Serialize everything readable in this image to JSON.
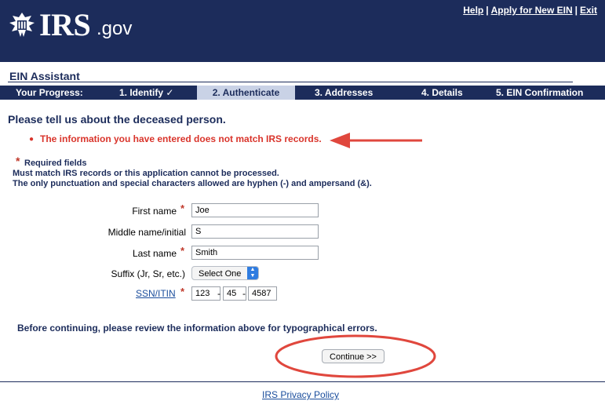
{
  "header": {
    "logo": "IRS",
    "logo_suffix": ".gov",
    "links": [
      "Help",
      "Apply for New EIN",
      "Exit"
    ],
    "separator": "|"
  },
  "assistant_title": "EIN Assistant",
  "progress": {
    "label": "Your Progress:",
    "steps": [
      {
        "label": "1. Identify ✓",
        "state": "complete"
      },
      {
        "label": "2. Authenticate",
        "state": "current"
      },
      {
        "label": "3. Addresses",
        "state": "upcoming"
      },
      {
        "label": "4. Details",
        "state": "upcoming"
      },
      {
        "label": "5. EIN Confirmation",
        "state": "upcoming"
      }
    ]
  },
  "prompt": "Please tell us about the deceased person.",
  "error_message": "The information you have entered does not match IRS records.",
  "required_note": "Required fields",
  "notes": [
    "Must match IRS records or this application cannot be processed.",
    "The only punctuation and special characters allowed are hyphen (-) and ampersand (&)."
  ],
  "form": {
    "first_name": {
      "label": "First name",
      "value": "Joe"
    },
    "middle_name": {
      "label": "Middle name/initial",
      "value": "S"
    },
    "last_name": {
      "label": "Last name",
      "value": "Smith"
    },
    "suffix": {
      "label": "Suffix (Jr, Sr, etc.)",
      "selected": "Select One"
    },
    "ssn": {
      "label": "SSN/ITIN",
      "part1": "123",
      "part2": "45",
      "part3": "4587",
      "separator": "-"
    }
  },
  "review_text": "Before continuing, please review the information above for typographical errors.",
  "continue_label": "Continue >>",
  "footer_link": "IRS Privacy Policy",
  "colors": {
    "navy": "#1c2c5b",
    "active_step": "#c9d2e6",
    "error": "#d9342b",
    "annotation": "#e0473d",
    "link": "#1a4d9c"
  }
}
